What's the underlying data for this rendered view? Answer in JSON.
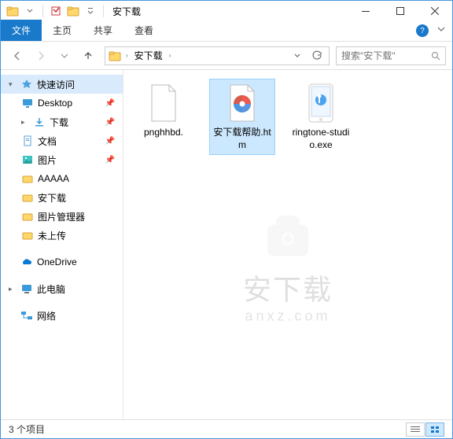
{
  "title": "安下载",
  "ribbon": {
    "file": "文件",
    "home": "主页",
    "share": "共享",
    "view": "查看"
  },
  "nav": {
    "address_root": "安下载",
    "search_placeholder": "搜索\"安下载\""
  },
  "sidebar": {
    "quick_access": "快速访问",
    "desktop": "Desktop",
    "downloads": "下载",
    "documents": "文档",
    "pictures": "图片",
    "aaaaa": "AAAAA",
    "anxiazai": "安下载",
    "picmgr": "图片管理器",
    "notuploaded": "未上传",
    "onedrive": "OneDrive",
    "thispc": "此电脑",
    "network": "网络"
  },
  "files": {
    "f1": "pnghhbd.",
    "f2": "安下载帮助.htm",
    "f3": "ringtone-studio.exe"
  },
  "watermark": {
    "main": "安下载",
    "sub": "anxz.com"
  },
  "status": {
    "items": "3 个项目"
  }
}
